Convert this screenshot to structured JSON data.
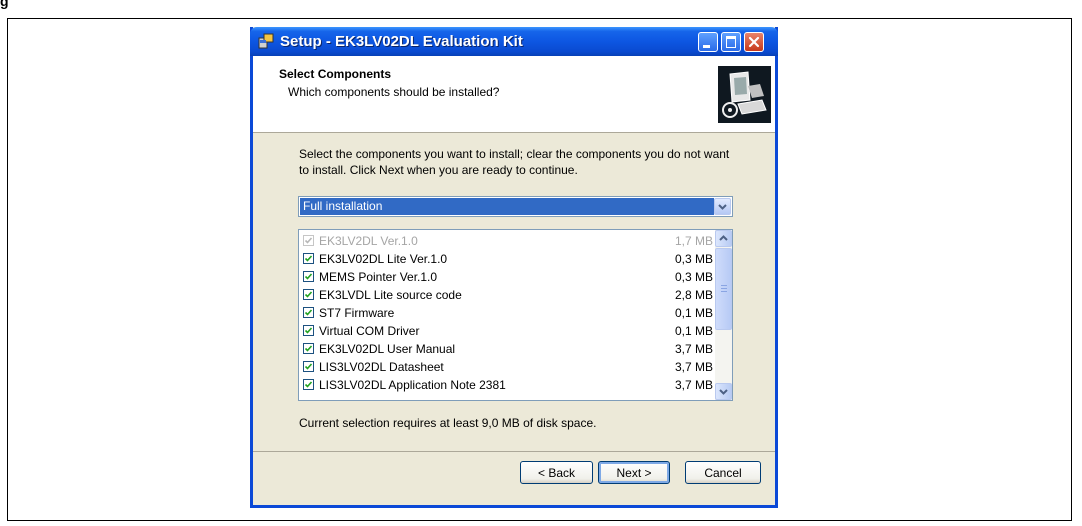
{
  "figure_label": "g",
  "window": {
    "title": "Setup - EK3LV02DL Evaluation Kit"
  },
  "header": {
    "title": "Select Components",
    "subtitle": "Which components should be installed?"
  },
  "description": "Select the components you want to install; clear the components you do not want to install. Click Next when you are ready to continue.",
  "install_type": {
    "selected": "Full installation"
  },
  "components": [
    {
      "label": "EK3LV2DL Ver.1.0",
      "size": "1,7 MB",
      "checked": true,
      "disabled": true
    },
    {
      "label": "EK3LV02DL Lite Ver.1.0",
      "size": "0,3 MB",
      "checked": true,
      "disabled": false
    },
    {
      "label": "MEMS Pointer Ver.1.0",
      "size": "0,3 MB",
      "checked": true,
      "disabled": false
    },
    {
      "label": "EK3LVDL Lite source code",
      "size": "2,8 MB",
      "checked": true,
      "disabled": false
    },
    {
      "label": "ST7 Firmware",
      "size": "0,1 MB",
      "checked": true,
      "disabled": false
    },
    {
      "label": "Virtual COM Driver",
      "size": "0,1 MB",
      "checked": true,
      "disabled": false
    },
    {
      "label": "EK3LV02DL User Manual",
      "size": "3,7 MB",
      "checked": true,
      "disabled": false
    },
    {
      "label": "LIS3LV02DL Datasheet",
      "size": "3,7 MB",
      "checked": true,
      "disabled": false
    },
    {
      "label": "LIS3LV02DL Application Note 2381",
      "size": "3,7 MB",
      "checked": true,
      "disabled": false
    }
  ],
  "disk_space": "Current selection requires at least 9,0 MB of disk space.",
  "buttons": {
    "back": "< Back",
    "next": "Next >",
    "cancel": "Cancel"
  },
  "colors": {
    "titlebar": "#0a4ad0",
    "selection": "#316ac5",
    "dialog_bg": "#ece9d8",
    "check": "#21a121"
  }
}
